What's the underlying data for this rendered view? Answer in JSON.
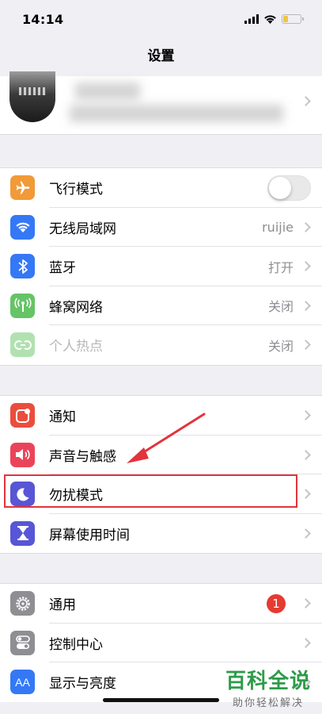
{
  "status_bar": {
    "time": "14:14"
  },
  "nav": {
    "title": "设置"
  },
  "group1": [
    {
      "label": "飞行模式",
      "icon": "airplane-icon",
      "color": "#f19a37",
      "type": "toggle",
      "toggle_on": false
    },
    {
      "label": "无线局域网",
      "icon": "wifi-icon",
      "color": "#3478f6",
      "value": "ruijie"
    },
    {
      "label": "蓝牙",
      "icon": "bluetooth-icon",
      "color": "#3478f6",
      "value": "打开"
    },
    {
      "label": "蜂窝网络",
      "icon": "antenna-icon",
      "color": "#65c466",
      "value": "关闭"
    },
    {
      "label": "个人热点",
      "icon": "hotspot-icon",
      "color": "#65c466",
      "value": "关闭",
      "disabled": true
    }
  ],
  "group2": [
    {
      "label": "通知",
      "icon": "notifications-icon",
      "color": "#eb4d3d"
    },
    {
      "label": "声音与触感",
      "icon": "speaker-icon",
      "color": "#eb445a"
    },
    {
      "label": "勿扰模式",
      "icon": "moon-icon",
      "color": "#5856d6"
    },
    {
      "label": "屏幕使用时间",
      "icon": "hourglass-icon",
      "color": "#5856d6"
    }
  ],
  "group3": [
    {
      "label": "通用",
      "icon": "gear-icon",
      "color": "#8e8e93",
      "badge": "1"
    },
    {
      "label": "控制中心",
      "icon": "switches-icon",
      "color": "#8e8e93"
    },
    {
      "label": "显示与亮度",
      "icon": "aa-icon",
      "color": "#3478f6",
      "icon_text": "AA"
    }
  ],
  "watermark": {
    "title": "百科全说",
    "subtitle": "助你轻松解决"
  }
}
